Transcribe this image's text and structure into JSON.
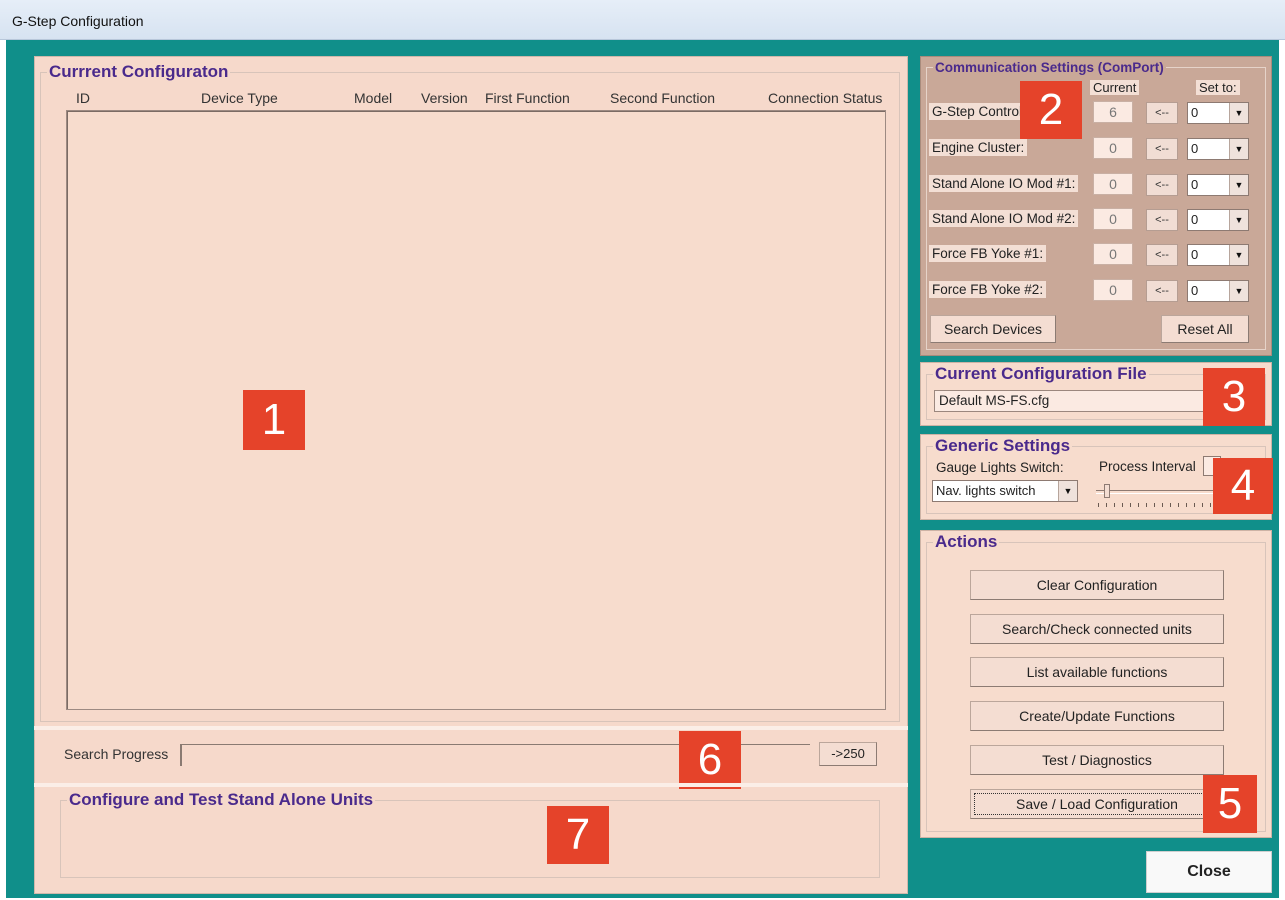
{
  "window": {
    "title": "G-Step Configuration"
  },
  "current_config": {
    "legend": "Currrent Configuraton",
    "columns": [
      "ID",
      "Device Type",
      "Model",
      "Version",
      "First Function",
      "Second Function",
      "Connection Status"
    ],
    "badge": "1"
  },
  "search": {
    "label": "Search Progress",
    "progress": 0,
    "button": "->250",
    "badge": "6"
  },
  "standalone": {
    "legend": "Configure and Test Stand Alone Units",
    "badge": "7"
  },
  "comm": {
    "legend": "Communication Settings (ComPort)",
    "current_header": "Current",
    "setto_header": "Set to:",
    "badge": "2",
    "rows": [
      {
        "label": "G-Step Control",
        "current": "6",
        "arrow": "<--",
        "set": "0"
      },
      {
        "label": "Engine Cluster:",
        "current": "0",
        "arrow": "<--",
        "set": "0"
      },
      {
        "label": "Stand Alone IO Mod #1:",
        "current": "0",
        "arrow": "<--",
        "set": "0"
      },
      {
        "label": "Stand Alone IO Mod #2:",
        "current": "0",
        "arrow": "<--",
        "set": "0"
      },
      {
        "label": "Force FB Yoke #1:",
        "current": "0",
        "arrow": "<--",
        "set": "0"
      },
      {
        "label": "Force FB Yoke #2:",
        "current": "0",
        "arrow": "<--",
        "set": "0"
      }
    ],
    "search_button": "Search Devices",
    "reset_button": "Reset All"
  },
  "config_file": {
    "legend": "Current Configuration File",
    "value": "Default MS-FS.cfg",
    "badge": "3"
  },
  "generic": {
    "legend": "Generic Settings",
    "gauge_label": "Gauge Lights Switch:",
    "gauge_value": "Nav. lights switch",
    "process_label": "Process Interval",
    "badge": "4"
  },
  "actions": {
    "legend": "Actions",
    "buttons": [
      "Clear Configuration",
      "Search/Check connected units",
      "List available functions",
      "Create/Update Functions",
      "Test / Diagnostics",
      "Save / Load Configuration"
    ],
    "badge": "5"
  },
  "close_button": "Close",
  "colors": {
    "client_bg": "#108f8a",
    "pane_bg": "#f6d9cb",
    "legend": "#4a2a8c",
    "badge": "#e5432a"
  }
}
